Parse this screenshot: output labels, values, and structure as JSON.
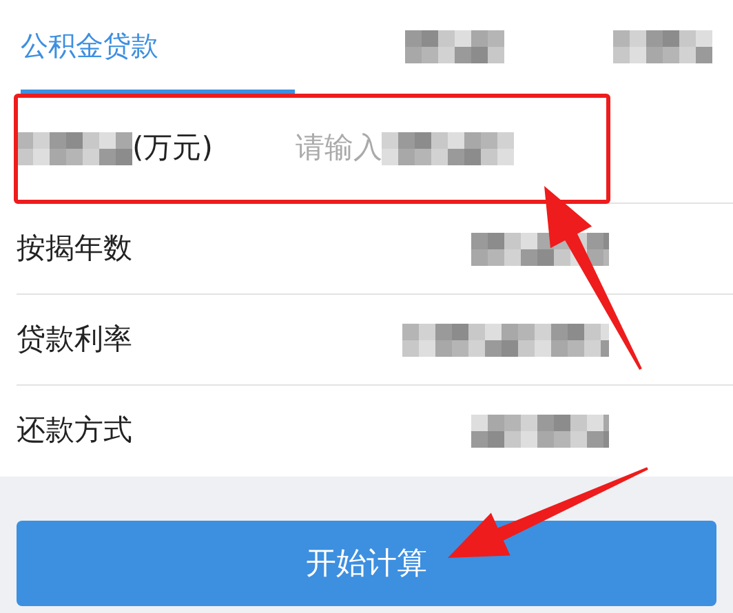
{
  "tabs": [
    {
      "label": "公积金贷款",
      "selected": true
    },
    {
      "redacted": true,
      "selected": false
    },
    {
      "redacted": true,
      "selected": false
    }
  ],
  "fields": [
    {
      "kind": "input",
      "label_redacted": true,
      "label": "(万元)",
      "placeholder": "请输入",
      "placeholder_redacted": true,
      "highlighted": true
    },
    {
      "kind": "select",
      "label": "按揭年数",
      "value_redacted": true,
      "highlighted": false
    },
    {
      "kind": "select",
      "label": "贷款利率",
      "value_redacted": true,
      "highlighted": false
    },
    {
      "kind": "select",
      "label": "还款方式",
      "value_redacted": true,
      "highlighted": false
    }
  ],
  "button": {
    "label": "开始计算"
  },
  "annotations": [
    {
      "kind": "arrow"
    },
    {
      "kind": "arrow"
    }
  ]
}
